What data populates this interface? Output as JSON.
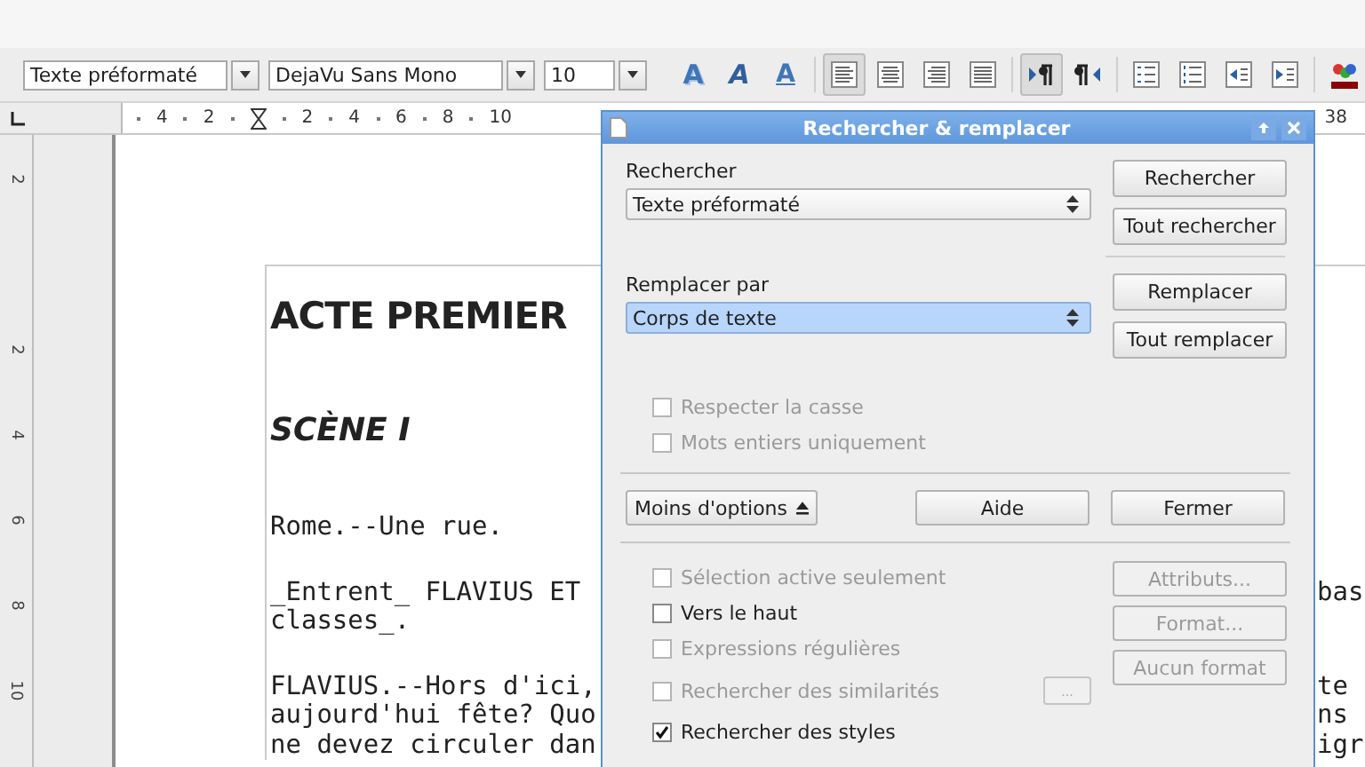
{
  "toolbar": {
    "paragraph_style": "Texte préformaté",
    "font_name": "DejaVu Sans Mono",
    "font_size": "10",
    "button_groups": [
      [
        {
          "kind": "shadow",
          "label": "A",
          "pressed": false
        },
        {
          "kind": "outline",
          "label": "A",
          "pressed": false
        },
        {
          "kind": "underline",
          "label": "A",
          "pressed": false
        }
      ],
      [
        {
          "kind": "left",
          "pressed": true
        },
        {
          "kind": "center",
          "pressed": false
        },
        {
          "kind": "right",
          "pressed": false
        },
        {
          "kind": "justify",
          "pressed": false
        }
      ],
      [
        {
          "kind": "ltr",
          "pressed": true
        },
        {
          "kind": "rtl",
          "pressed": false
        }
      ],
      [
        {
          "kind": "numbering",
          "pressed": false
        },
        {
          "kind": "bullets",
          "pressed": false
        },
        {
          "kind": "outdent",
          "pressed": false
        },
        {
          "kind": "indent",
          "pressed": false
        }
      ],
      [
        {
          "kind": "color",
          "pressed": false
        }
      ]
    ]
  },
  "ruler": {
    "left_labels": [
      "4",
      "2"
    ],
    "right_labels": [
      "2",
      "4",
      "6",
      "8",
      "10"
    ],
    "end_label": "38"
  },
  "vertical_ruler": {
    "labels": [
      "2",
      "2",
      "4",
      "6",
      "8",
      "10"
    ]
  },
  "document": {
    "heading": "ACTE PREMIER",
    "scene": "SCÈNE I",
    "paragraphs": [
      {
        "lines": [
          {
            "left": "Rome.--Une rue."
          }
        ]
      },
      {
        "lines": [
          {
            "left": "_Entrent_ FLAVIUS ET",
            "right": "bas"
          },
          {
            "left": "classes_."
          }
        ]
      },
      {
        "lines": [
          {
            "left": "FLAVIUS.--Hors d'ici,",
            "right": "te"
          },
          {
            "left": "aujourd'hui fête? Quo",
            "right": "ns"
          },
          {
            "left": "ne devez circuler dan",
            "right": "igr"
          }
        ]
      }
    ]
  },
  "dialog": {
    "title": "Rechercher & remplacer",
    "search": {
      "label": "Rechercher",
      "value": "Texte préformaté",
      "focused": false
    },
    "search_buttons": [
      {
        "label": "Rechercher"
      },
      {
        "label": "Tout rechercher"
      }
    ],
    "replace": {
      "label": "Remplacer par",
      "value": "Corps de texte",
      "focused": true
    },
    "replace_buttons": [
      {
        "label": "Remplacer"
      },
      {
        "label": "Tout remplacer"
      }
    ],
    "match_options": [
      {
        "label": "Respecter la casse",
        "checked": false,
        "disabled": true
      },
      {
        "label": "Mots entiers uniquement",
        "checked": false,
        "disabled": true
      }
    ],
    "footer_buttons": [
      {
        "label": "Moins d'options",
        "kind": "toggle"
      },
      {
        "label": "Aide",
        "kind": "plain"
      },
      {
        "label": "Fermer",
        "kind": "plain"
      }
    ],
    "more_options": [
      {
        "label": "Sélection active seulement",
        "checked": false,
        "disabled": true
      },
      {
        "label": "Vers le haut",
        "checked": false,
        "disabled": false
      },
      {
        "label": "Expressions régulières",
        "checked": false,
        "disabled": true
      },
      {
        "label": "Rechercher des similarités",
        "checked": false,
        "disabled": true,
        "button": {
          "label": "...",
          "disabled": true
        }
      },
      {
        "label": "Rechercher des styles",
        "checked": true,
        "disabled": false
      }
    ],
    "format_buttons": [
      {
        "label": "Attributs...",
        "disabled": true
      },
      {
        "label": "Format...",
        "disabled": true
      },
      {
        "label": "Aucun format",
        "disabled": true
      }
    ]
  }
}
